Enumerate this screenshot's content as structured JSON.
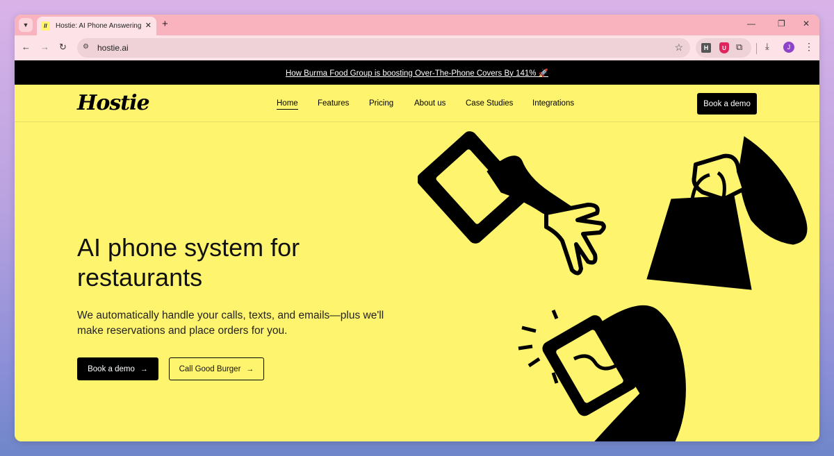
{
  "browser": {
    "tab": {
      "favicon": "//",
      "title": "Hostie: AI Phone Answering for",
      "close_icon": "✕"
    },
    "new_tab_icon": "+",
    "window_controls": {
      "minimize": "—",
      "restore": "❐",
      "close": "✕"
    },
    "toolbar": {
      "back": "←",
      "forward": "→",
      "reload": "↻",
      "url": "hostie.ai",
      "bookmark_icon": "☆",
      "extensions": [
        "H",
        "U"
      ],
      "avatar_initial": "J"
    }
  },
  "page": {
    "announcement": "How Burma Food Group is boosting Over-The-Phone Covers By 141% 🚀",
    "logo": "Hostie",
    "nav": {
      "items": [
        {
          "label": "Home"
        },
        {
          "label": "Features"
        },
        {
          "label": "Pricing"
        },
        {
          "label": "About us"
        },
        {
          "label": "Case Studies"
        },
        {
          "label": "Integrations"
        }
      ],
      "active": "Home",
      "cta": "Book a demo"
    },
    "hero": {
      "title": "AI phone system for restaurants",
      "subtitle": "We automatically handle your calls, texts, and emails—plus we'll make reservations and place orders for you.",
      "primary_button": "Book a demo",
      "secondary_button": "Call Good Burger",
      "arrow": "→"
    }
  },
  "colors": {
    "page_background": "#fff46d",
    "announcement_bar": "#000000",
    "tab_strip": "#f9b3bf",
    "toolbar": "#fde3e8"
  }
}
